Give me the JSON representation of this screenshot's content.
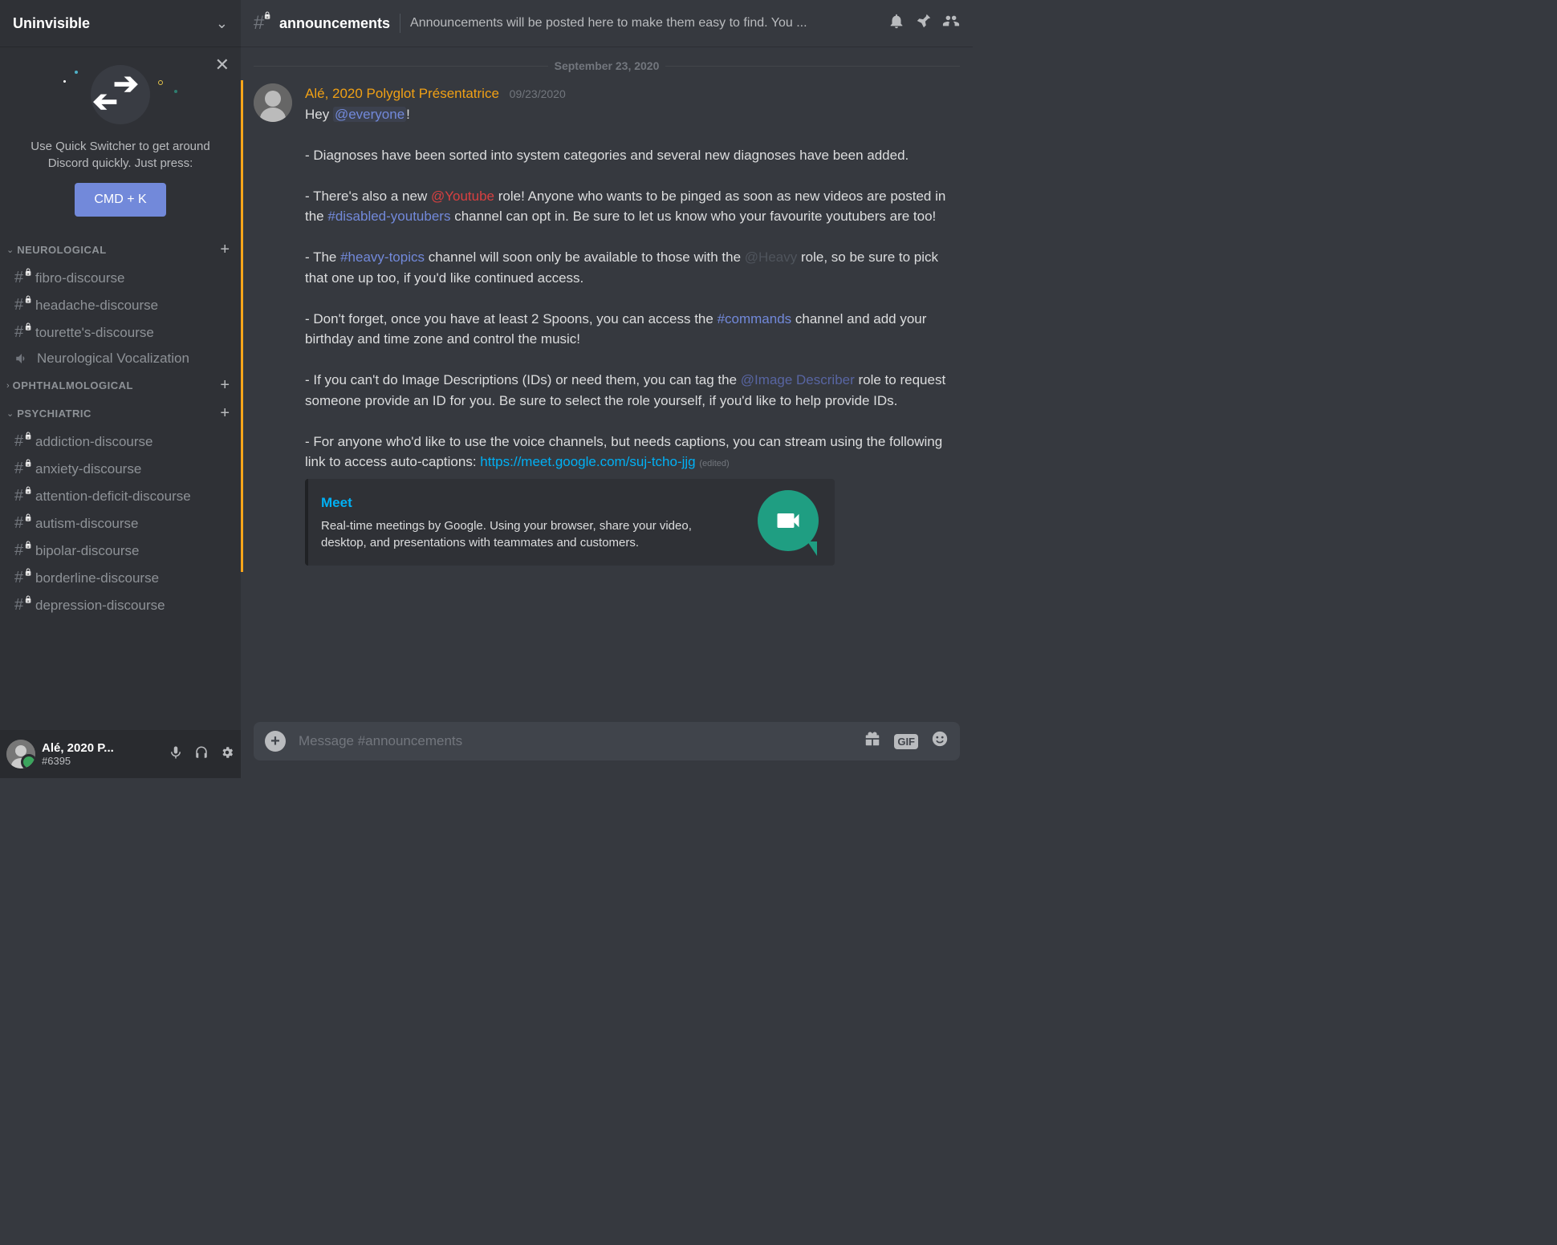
{
  "server": {
    "name": "Uninvisible"
  },
  "quickswitcher": {
    "desc": "Use Quick Switcher to get around Discord quickly. Just press:",
    "button": "CMD + K"
  },
  "categories": [
    {
      "name": "NEUROLOGICAL",
      "collapsed": false,
      "channels": [
        {
          "name": "fibro-discourse",
          "type": "text-locked"
        },
        {
          "name": "headache-discourse",
          "type": "text-locked"
        },
        {
          "name": "tourette's-discourse",
          "type": "text-locked"
        },
        {
          "name": "Neurological Vocalization",
          "type": "voice"
        }
      ]
    },
    {
      "name": "OPHTHALMOLOGICAL",
      "collapsed": true,
      "channels": []
    },
    {
      "name": "PSYCHIATRIC",
      "collapsed": false,
      "channels": [
        {
          "name": "addiction-discourse",
          "type": "text-locked"
        },
        {
          "name": "anxiety-discourse",
          "type": "text-locked"
        },
        {
          "name": "attention-deficit-discourse",
          "type": "text-locked"
        },
        {
          "name": "autism-discourse",
          "type": "text-locked"
        },
        {
          "name": "bipolar-discourse",
          "type": "text-locked"
        },
        {
          "name": "borderline-discourse",
          "type": "text-locked"
        },
        {
          "name": "depression-discourse",
          "type": "text-locked"
        }
      ]
    }
  ],
  "user": {
    "name": "Alé, 2020 P...",
    "tag": "#6395"
  },
  "channelHeader": {
    "name": "announcements",
    "topic": "Announcements will be posted here to make them easy to find. You ..."
  },
  "dateDivider": "September 23, 2020",
  "message": {
    "author": "Alé, 2020 Polyglot Présentatrice",
    "timestamp": "09/23/2020",
    "parts": {
      "hey": "Hey ",
      "everyone": "@everyone",
      "exclaim": "!",
      "p1": "- Diagnoses have been sorted into system categories and several new diagnoses have been added.",
      "p2a": "- There's also a new ",
      "youtube": "@Youtube",
      "p2b": " role! Anyone who wants to be pinged as soon as new videos are posted in the ",
      "disabledYt": "#disabled-youtubers",
      "p2c": " channel can opt in. Be sure to let us know who your favourite youtubers are too!",
      "p3a": "- The ",
      "heavy": "#heavy-topics",
      "p3b": " channel will soon only be available to those with the ",
      "heavyRole": "@Heavy",
      "p3c": " role, so be sure to pick that one up too, if you'd like continued access.",
      "p4a": "- Don't forget, once you have at least 2 Spoons, you can access the ",
      "commands": "#commands",
      "p4b": " channel and add your birthday and time zone and control the music!",
      "p5a": "- If you can't do Image Descriptions (IDs) or need them, you can tag the ",
      "imgDesc": "@Image Describer",
      "p5b": " role to request someone provide an ID for you. Be sure to select the role yourself, if you'd like to help provide IDs.",
      "p6a": "- For anyone who'd like to use the voice channels, but needs captions, you can stream using the following link to access auto-captions: ",
      "link": "https://meet.google.com/suj-tcho-jjg",
      "edited": "(edited)"
    }
  },
  "embed": {
    "title": "Meet",
    "desc": "Real-time meetings by Google. Using your browser, share your video, desktop, and presentations with teammates and customers."
  },
  "input": {
    "placeholder": "Message #announcements",
    "gif": "GIF"
  }
}
